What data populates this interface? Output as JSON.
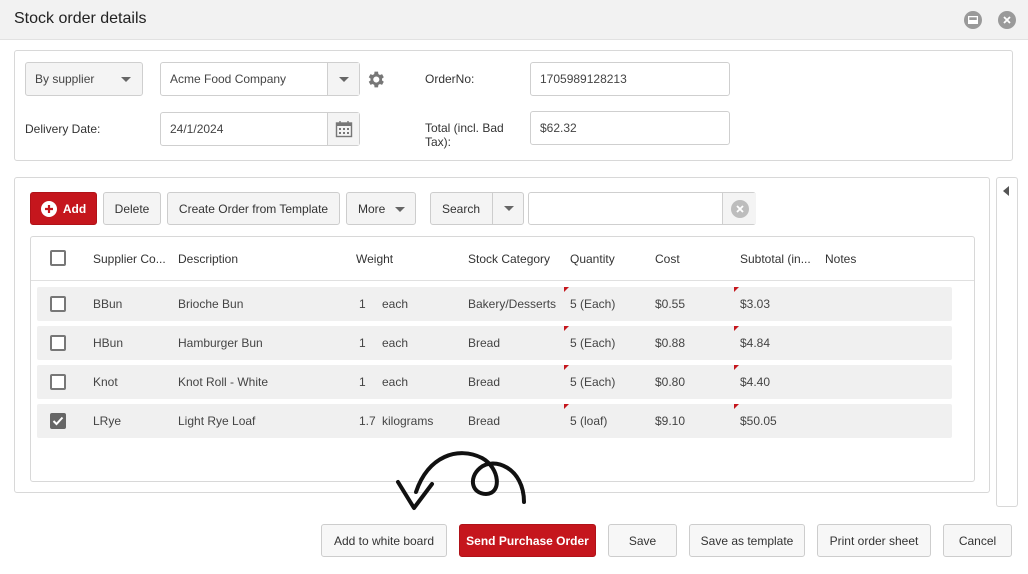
{
  "window": {
    "title": "Stock order details"
  },
  "header": {
    "order_by": "By supplier",
    "supplier": "Acme Food Company",
    "order_no_label": "OrderNo:",
    "order_no": "1705989128213",
    "delivery_date_label": "Delivery Date:",
    "delivery_date": "24/1/2024",
    "total_label": "Total (incl. Bad Tax):",
    "total": "$62.32"
  },
  "toolbar": {
    "add": "Add",
    "delete": "Delete",
    "create_from_template": "Create Order from Template",
    "more": "More",
    "search_mode": "Search",
    "search_value": ""
  },
  "table": {
    "columns": [
      "Supplier Co...",
      "Description",
      "Weight",
      "Stock Category",
      "Quantity",
      "Cost",
      "Subtotal (in...",
      "Notes"
    ],
    "rows": [
      {
        "checked": false,
        "code": "BBun",
        "description": "Brioche Bun",
        "weight": "1",
        "unit": "each",
        "category": "Bakery/Desserts",
        "quantity": "5 (Each)",
        "cost": "$0.55",
        "subtotal": "$3.03",
        "notes": ""
      },
      {
        "checked": false,
        "code": "HBun",
        "description": "Hamburger Bun",
        "weight": "1",
        "unit": "each",
        "category": "Bread",
        "quantity": "5 (Each)",
        "cost": "$0.88",
        "subtotal": "$4.84",
        "notes": ""
      },
      {
        "checked": false,
        "code": "Knot",
        "description": "Knot Roll - White",
        "weight": "1",
        "unit": "each",
        "category": "Bread",
        "quantity": "5 (Each)",
        "cost": "$0.80",
        "subtotal": "$4.40",
        "notes": ""
      },
      {
        "checked": true,
        "code": "LRye",
        "description": "Light Rye Loaf",
        "weight": "1.7",
        "unit": "kilograms",
        "category": "Bread",
        "quantity": "5 (loaf)",
        "cost": "$9.10",
        "subtotal": "$50.05",
        "notes": ""
      }
    ]
  },
  "footer": {
    "add_whiteboard": "Add to white board",
    "send_po": "Send Purchase Order",
    "save": "Save",
    "save_template": "Save as template",
    "print": "Print order sheet",
    "cancel": "Cancel"
  },
  "colors": {
    "accent": "#c5161d",
    "row_bg": "#f0f0f0"
  },
  "icons": [
    "minimize-icon",
    "close-icon",
    "gear-icon",
    "calendar-icon",
    "plus-circle-icon",
    "chevron-down-icon",
    "clear-search-icon",
    "collapse-left-icon",
    "annotation-arrow-icon"
  ]
}
